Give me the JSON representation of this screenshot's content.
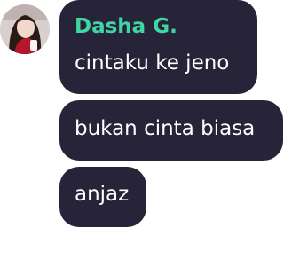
{
  "chat": {
    "sender": {
      "name": "Dasha G.",
      "name_color": "#3fd6a4",
      "avatar_icon": "profile-photo"
    },
    "bubble_color": "#27243a",
    "messages": [
      {
        "text": "cintaku ke jeno"
      },
      {
        "text": "bukan cinta biasa"
      },
      {
        "text": "anjaz"
      }
    ]
  }
}
